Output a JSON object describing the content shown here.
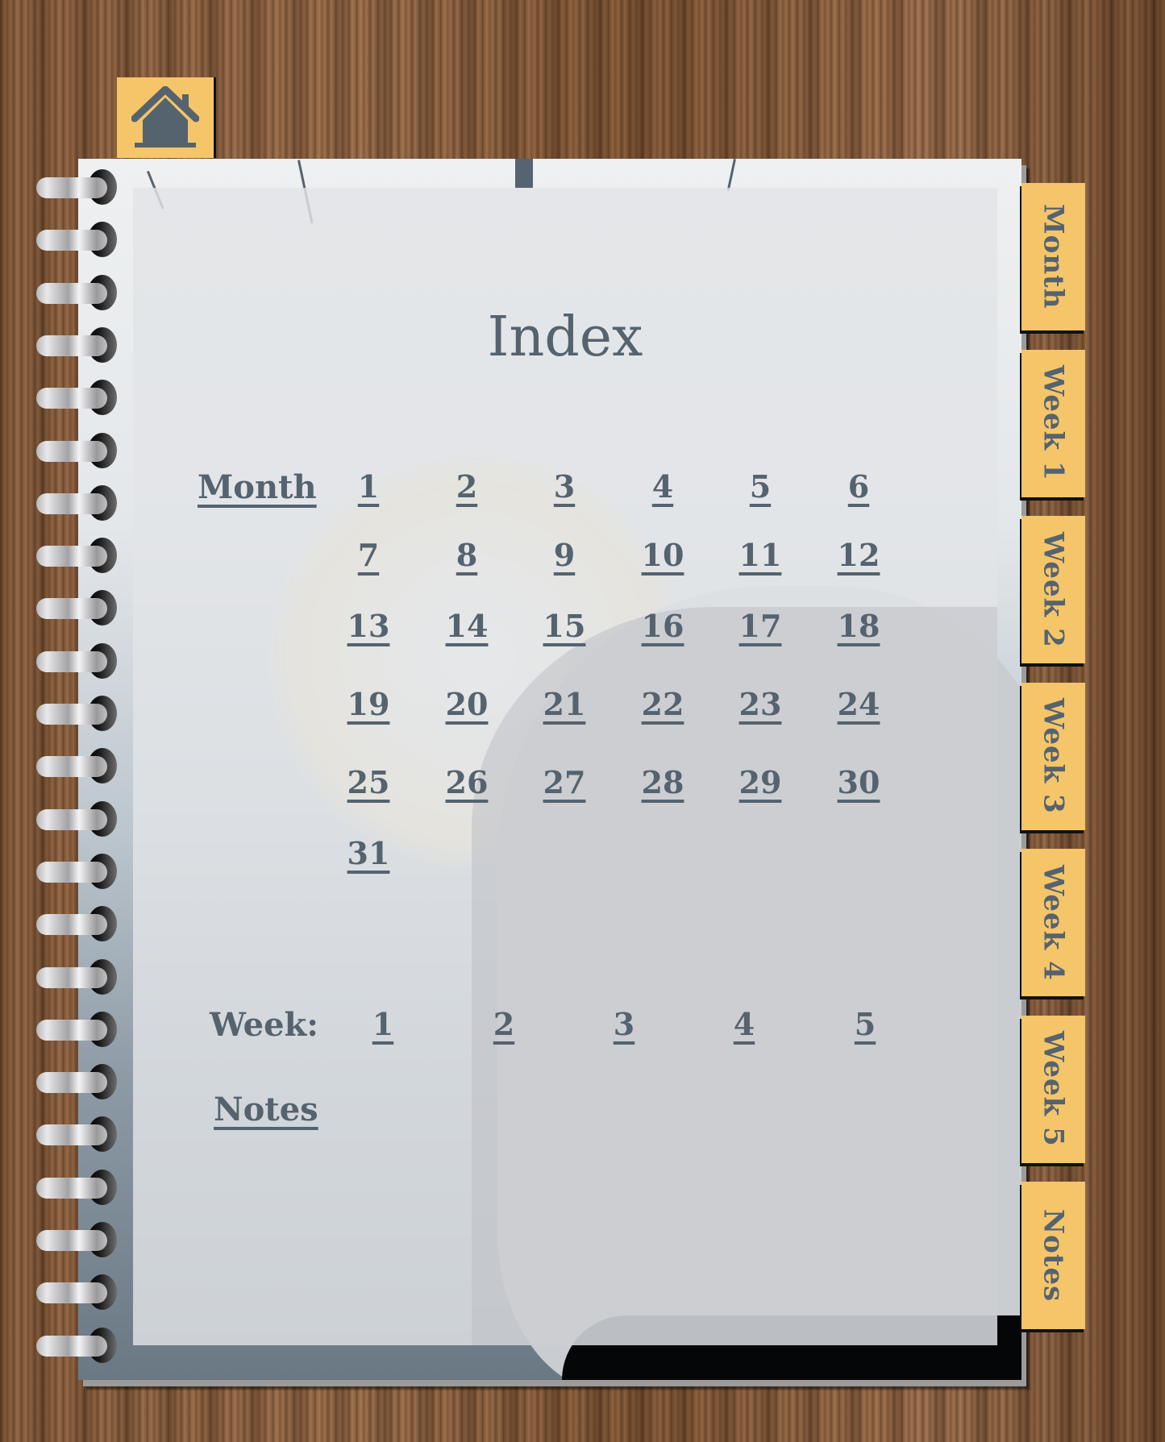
{
  "home": {
    "icon": "home-icon"
  },
  "page": {
    "title": "Index"
  },
  "month": {
    "label": "Month",
    "days": [
      "1",
      "2",
      "3",
      "4",
      "5",
      "6",
      "7",
      "8",
      "9",
      "10",
      "11",
      "12",
      "13",
      "14",
      "15",
      "16",
      "17",
      "18",
      "19",
      "20",
      "21",
      "22",
      "23",
      "24",
      "25",
      "26",
      "27",
      "28",
      "29",
      "30",
      "31"
    ]
  },
  "week": {
    "label": "Week:",
    "items": [
      "1",
      "2",
      "3",
      "4",
      "5"
    ]
  },
  "notes": {
    "label": "Notes"
  },
  "side_tabs": [
    "Month",
    "Week 1",
    "Week 2",
    "Week 3",
    "Week 4",
    "Week 5",
    "Notes"
  ],
  "colors": {
    "tab": "#f5c56a",
    "text": "#55636f"
  }
}
